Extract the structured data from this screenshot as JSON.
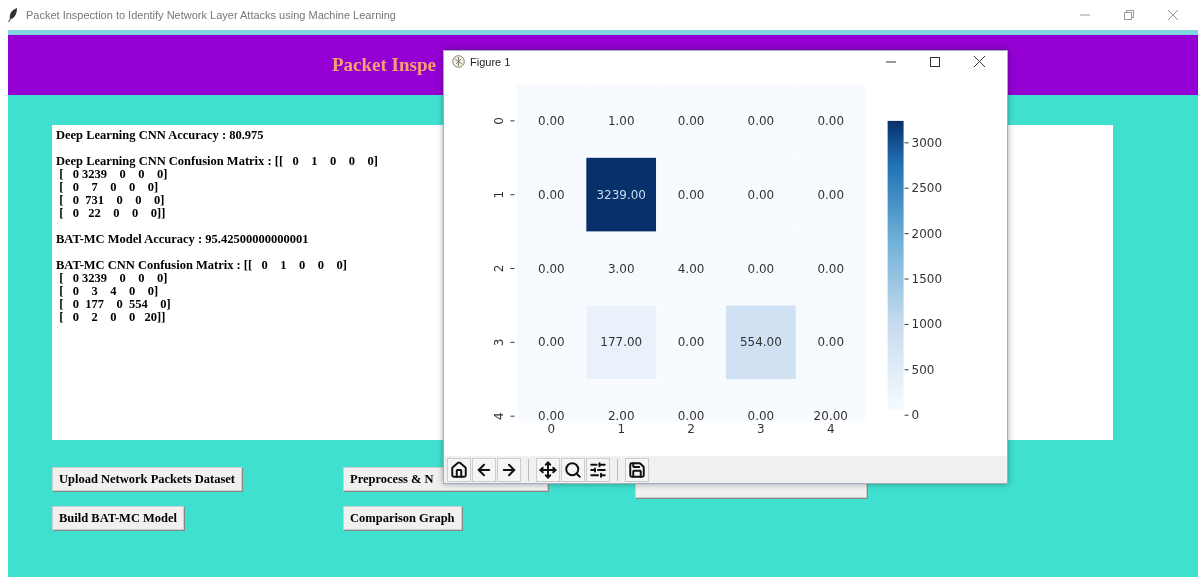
{
  "window": {
    "title": "Packet Inspection to Identify Network Layer Attacks using Machine Learning"
  },
  "header": {
    "title": "Packet Inspe"
  },
  "output": [
    [
      "Deep Learning CNN Accuracy : 80.975"
    ],
    [
      "Deep Learning CNN Confusion Matrix : [[   0    1    0    0    0]",
      " [   0 3239    0    0    0]",
      " [   0    7    0    0    0]",
      " [   0  731    0    0    0]",
      " [   0   22    0    0    0]]"
    ],
    [
      "BAT-MC Model Accuracy : 95.42500000000001"
    ],
    [
      "BAT-MC CNN Confusion Matrix : [[   0    1    0    0    0]",
      " [   0 3239    0    0    0]",
      " [   0    3    4    0    0]",
      " [   0  177    0  554    0]",
      " [   0    2    0    0   20]]"
    ]
  ],
  "buttons": [
    [
      {
        "label": "Upload Network Packets Dataset"
      },
      {
        "label": "Preprocess & N"
      }
    ],
    [
      {
        "label": "Build BAT-MC Model"
      },
      {
        "label": "Comparison Graph"
      }
    ]
  ],
  "figure": {
    "title": "Figure 1",
    "row_labels": [
      "0",
      "1",
      "2",
      "3",
      "4"
    ],
    "col_labels": [
      "0",
      "1",
      "2",
      "3",
      "4"
    ],
    "rows": [
      [
        {
          "text": "0.00",
          "color": "#f7fbff"
        },
        {
          "text": "1.00",
          "color": "#f7fbff"
        },
        {
          "text": "0.00",
          "color": "#f7fbff"
        },
        {
          "text": "0.00",
          "color": "#f7fbff"
        },
        {
          "text": "0.00",
          "color": "#f7fbff"
        }
      ],
      [
        {
          "text": "0.00",
          "color": "#f7fbff"
        },
        {
          "text": "3239.00",
          "color": "#08306b"
        },
        {
          "text": "0.00",
          "color": "#f7fbff"
        },
        {
          "text": "0.00",
          "color": "#f7fbff"
        },
        {
          "text": "0.00",
          "color": "#f7fbff"
        }
      ],
      [
        {
          "text": "0.00",
          "color": "#f7fbff"
        },
        {
          "text": "3.00",
          "color": "#f7fbff"
        },
        {
          "text": "4.00",
          "color": "#f7fbff"
        },
        {
          "text": "0.00",
          "color": "#f7fbff"
        },
        {
          "text": "0.00",
          "color": "#f7fbff"
        }
      ],
      [
        {
          "text": "0.00",
          "color": "#f7fbff"
        },
        {
          "text": "177.00",
          "color": "#e9f1fa"
        },
        {
          "text": "0.00",
          "color": "#f7fbff"
        },
        {
          "text": "554.00",
          "color": "#cfe1f2"
        },
        {
          "text": "0.00",
          "color": "#f7fbff"
        }
      ],
      [
        {
          "text": "0.00",
          "color": "#f7fbff"
        },
        {
          "text": "2.00",
          "color": "#f7fbff"
        },
        {
          "text": "0.00",
          "color": "#f7fbff"
        },
        {
          "text": "0.00",
          "color": "#f7fbff"
        },
        {
          "text": "20.00",
          "color": "#f7fbff"
        }
      ]
    ],
    "colorbar_ticks": [
      "3000",
      "2500",
      "2000",
      "1500",
      "1000",
      "500",
      "0"
    ]
  }
}
